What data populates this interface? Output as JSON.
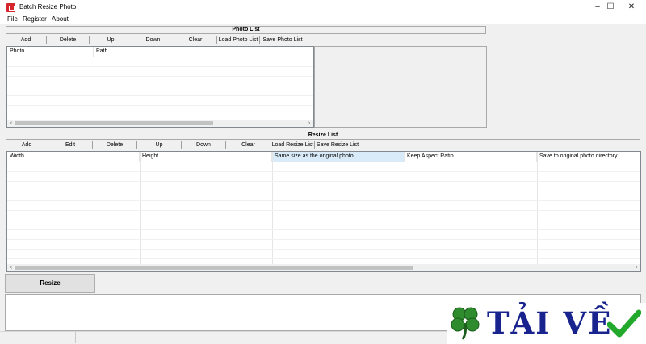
{
  "window": {
    "title": "Batch Resize Photo",
    "controls": [
      "–",
      "☐",
      "✕"
    ]
  },
  "menu": [
    "File",
    "Register",
    "About"
  ],
  "photo_list": {
    "header": "Photo List",
    "toolbar": [
      "Add",
      "Delete",
      "Up",
      "Down",
      "Clear",
      "Load Photo List",
      "Save Photo List"
    ],
    "columns": [
      "Photo",
      "Path"
    ]
  },
  "resize_list": {
    "header": "Resize List",
    "toolbar": [
      "Add",
      "Edit",
      "Delete",
      "Up",
      "Down",
      "Clear",
      "Load Resize List",
      "Save Resize List"
    ],
    "columns": [
      "Width",
      "Height",
      "Same size as the original photo",
      "Keep Aspect Ratio",
      "Save to original photo directory"
    ]
  },
  "resize_button": "Resize",
  "watermark": {
    "text": "TẢI VỀ",
    "clover_color": "#2e8b2e",
    "check_color": "#22a82a"
  },
  "colors": {
    "highlight_column": "#d9ebf9",
    "watermark_text": "#18238e"
  }
}
